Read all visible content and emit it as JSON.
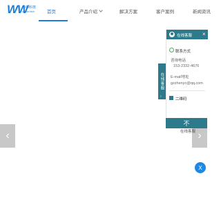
{
  "logo": {
    "mark": "WW",
    "name_cn": "伟伟科技",
    "name_en": "weiwei tech"
  },
  "nav": {
    "items": [
      "首页",
      "产品介绍",
      "解决方案",
      "客户案例",
      "新闻资讯"
    ],
    "active_index": 0
  },
  "side_tab": {
    "label": "在线客服"
  },
  "panel": {
    "header_title": "在线客服",
    "close": "×",
    "contact_title": "联系方式",
    "phone_label": "咨询电话",
    "phone_value": "153-2332-4676",
    "email_label": "E-mail地址",
    "email_value": "gzzhenyc@qq.com",
    "qr_title": "二维码",
    "online_link": "在线客服"
  },
  "buttons": {
    "top": "不",
    "round_close": "X",
    "prev": "‹",
    "next": "›"
  },
  "colors": {
    "brand": "#1a7bd9",
    "panel_accent": "#2c7a8c",
    "round_button": "#1e88e5",
    "arrow_bg": "#c8c8c8"
  },
  "icons": [
    "logo-icon",
    "chevron-down-icon",
    "customer-service-icon",
    "close-icon",
    "contact-icon",
    "qr-code-icon",
    "arrow-left-icon",
    "arrow-right-icon",
    "back-to-top-icon"
  ]
}
